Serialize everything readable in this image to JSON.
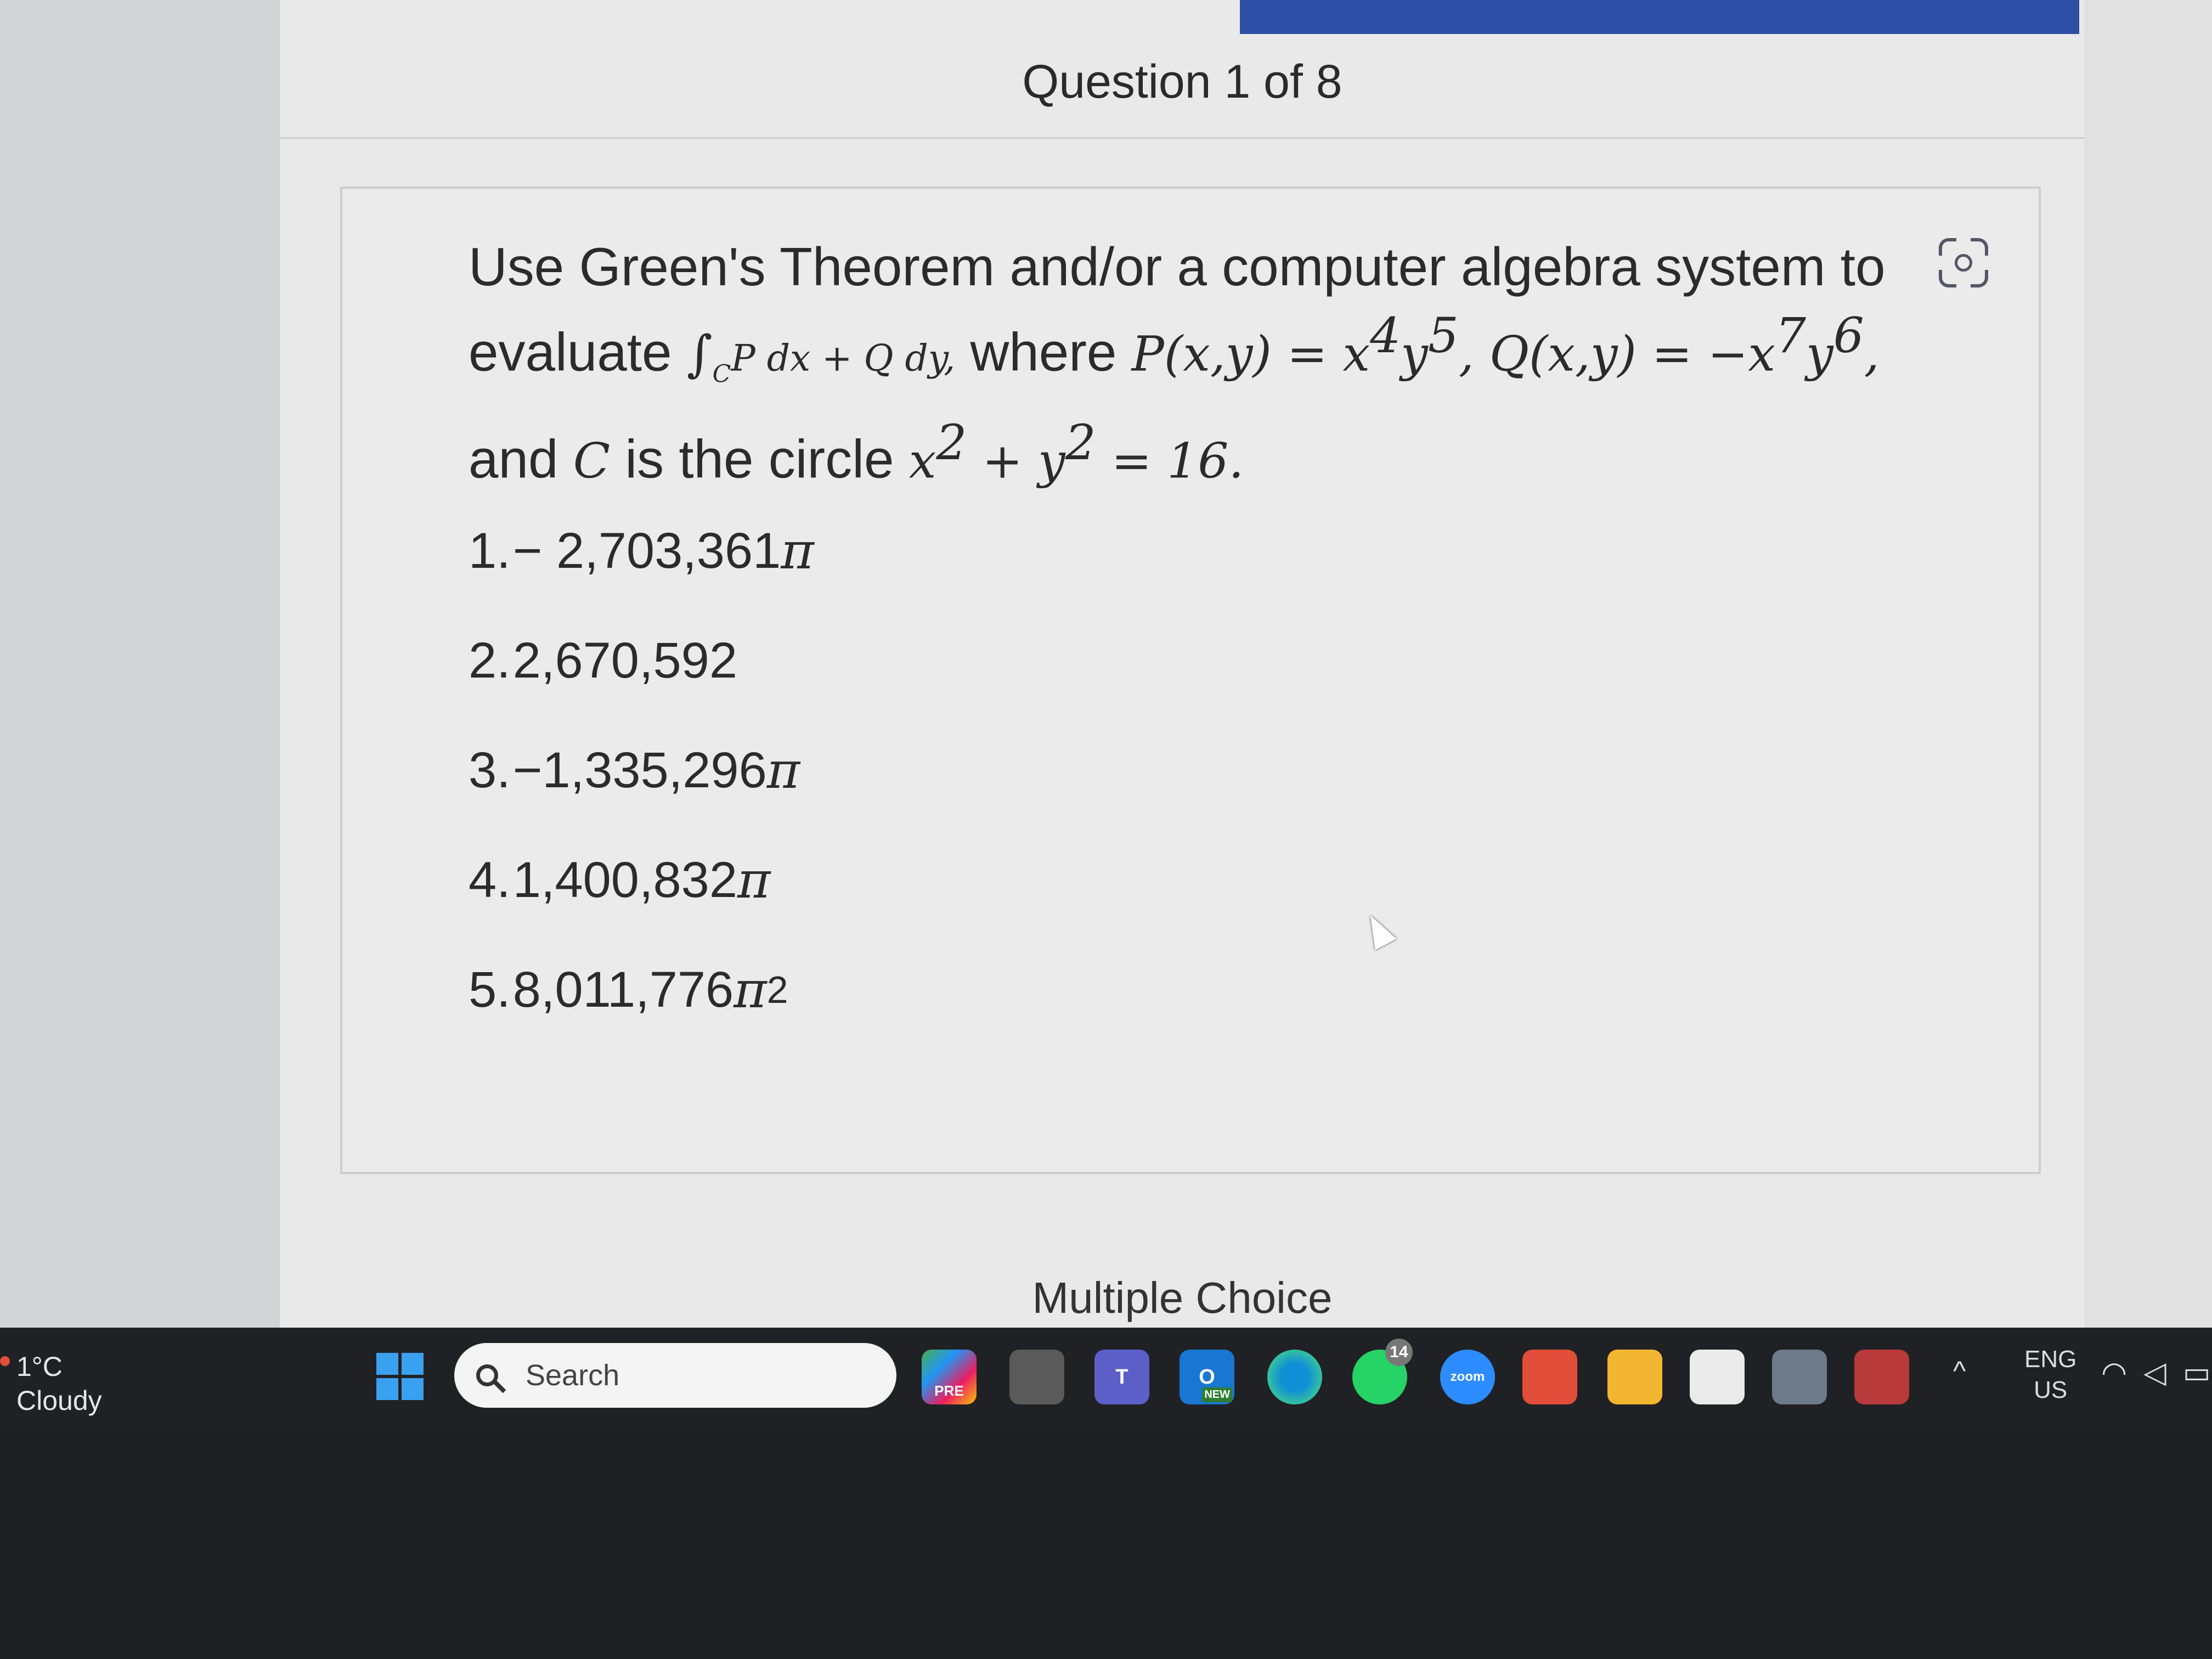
{
  "header": {
    "title": "Question 1 of 8"
  },
  "question": {
    "line1": "Use Green's Theorem and/or a computer algebra system to",
    "line2_prefix": "evaluate ",
    "integral_symbol": "∫",
    "integral_sub": "C",
    "integrand": "P dx + Q dy,",
    "line2_where": " where ",
    "P_def": "P(x,y) = x",
    "P_exp1": "4",
    "P_y": "y",
    "P_exp2": "5",
    "Q_def": ", Q(x,y) = −x",
    "Q_exp1": "7",
    "Q_y": "y",
    "Q_exp2": "6",
    "Q_end": ",",
    "line3_prefix": "and ",
    "C_var": "C",
    "line3_mid": " is the circle ",
    "circle_x": "x",
    "circle_x_exp": "2",
    "circle_plus": " + y",
    "circle_y_exp": "2",
    "circle_end": " = 16."
  },
  "answers": [
    {
      "num": "1.",
      "value": "− 2,703,361",
      "suffix": "π",
      "exp": ""
    },
    {
      "num": "2.",
      "value": "2,670,592",
      "suffix": "",
      "exp": ""
    },
    {
      "num": "3.",
      "value": "−1,335,296",
      "suffix": "π",
      "exp": ""
    },
    {
      "num": "4.",
      "value": "1,400,832",
      "suffix": "π",
      "exp": ""
    },
    {
      "num": "5.",
      "value": "8,011,776",
      "suffix": "π",
      "exp": "2"
    }
  ],
  "footer": {
    "multiple_choice": "Multiple Choice"
  },
  "taskbar": {
    "weather_temp": "1°C",
    "weather_desc": "Cloudy",
    "search_label": "Search",
    "whatsapp_badge": "14",
    "zoom_label": "zoom",
    "teams_label": "T",
    "outlook_label": "O",
    "new_label": "NEW",
    "pre_label": "PRE",
    "lang_top": "ENG",
    "lang_bottom": "US",
    "tray_chevron": "^"
  },
  "colors": {
    "accent": "#2e4fa6",
    "taskbar": "#202124",
    "page": "#e9e9e9"
  }
}
